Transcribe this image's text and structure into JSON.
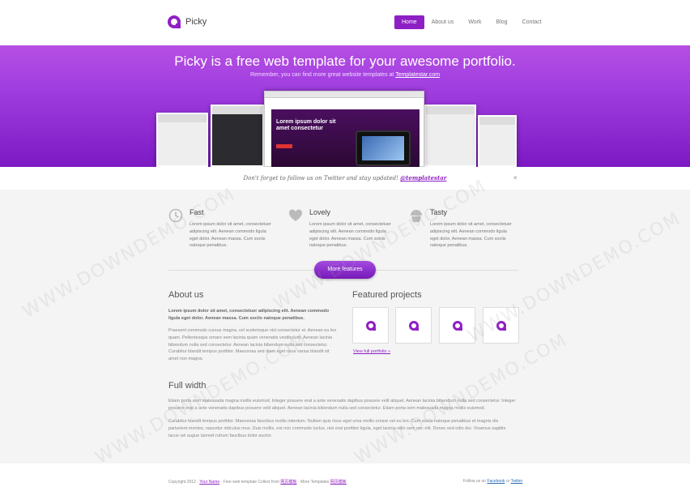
{
  "header": {
    "logo_text": "Picky",
    "nav": [
      "Home",
      "About us",
      "Work",
      "Blog",
      "Contact"
    ]
  },
  "hero": {
    "title": "Picky is a free web template for your awesome portfolio.",
    "subtitle_prefix": "Remember, you can find more great website templates at ",
    "subtitle_link": "Templatestar.com",
    "mockup_headline": "Lorem ipsum dolor sit amet consectetur"
  },
  "notice": {
    "text": "Don't forget to follow us on Twitter and stay updated! ",
    "handle": "@templatestar",
    "close": "×"
  },
  "features": [
    {
      "title": "Fast",
      "icon": "clock-icon",
      "text": "Lorem ipsum dolor sit amet, consectetuer adipiscing elit. Aenean commodo ligula eget dolor. Aenean massa. Cum sociis natoque penatibus."
    },
    {
      "title": "Lovely",
      "icon": "heart-icon",
      "text": "Lorem ipsum dolor sit amet, consectetuer adipiscing elit. Aenean commodo ligula eget dolor. Aenean massa. Cum sociis natoque penatibus."
    },
    {
      "title": "Tasty",
      "icon": "cupcake-icon",
      "text": "Lorem ipsum dolor sit amet, consectetuer adipiscing elit. Aenean commodo ligula eget dolor. Aenean massa. Cum sociis natoque penatibus."
    }
  ],
  "more_features": "More features",
  "about": {
    "title": "About us",
    "lead": "Lorem ipsum dolor sit amet, consectetuer adipiscing elit. Aenean commodo ligula eget dolor. Aenean massa. Cum sociis natoque penatibus.",
    "body": "Praesent commodo cursus magna, vel scelerisque nisl consectetur et. Aenean eu leo quam. Pellentesque ornare sem lacinia quam venenatis vestibulum. Aenean lacinia bibendum nulla sed consectetur. Aenean lacinia bibendum nulla sed consectetur. Curabitur blandit tempus porttitor. Maecenas sed diam eget risus varius blandit sit amet non magna."
  },
  "projects": {
    "title": "Featured projects",
    "view_all": "View full portfolio »"
  },
  "full_width": {
    "title": "Full width",
    "p1": "Etiam porta sem malesuada magna mollis euismod. Integer posuere erat a ante venenatis dapibus posuere velit aliquet. Aenean lacinia bibendum nulla sed consectetur. Integer posuere erat a ante venenatis dapibus posuere velit aliquet. Aenean lacinia bibendum nulla sed consectetur. Etiam porta sem malesuada magna mollis euismod.",
    "p2": "Curabitur blandit tempus porttitor. Maecenas faucibus mollis interdum. Nullam quis risus eget urna mollis ornare vel eu leo. Cum sociis natoque penatibus et magnis dis parturient montes, nascetur ridiculus mus. Duis mollis, est non commodo luctus, nisi erat porttitor ligula, eget lacinia odio sem nec elit. Donec sed odio dui. Vivamus sagittis lacus vel augue laoreet rutrum faucibus dolor auctor."
  },
  "footer": {
    "left_prefix": "Copyright 2012 · ",
    "your_name": "Your Name",
    "left_mid": " · Free web template Collect from ",
    "collect": "网页模板",
    "left_more": " · More Templates ",
    "more_link": "网页模板",
    "right_prefix": "Follow us on ",
    "facebook": "Facebook",
    "or": " or ",
    "twitter": "Twitter"
  },
  "watermark": "WWW.DOWNDEMO.COM",
  "colors": {
    "accent": "#8e1fc4",
    "hero_top": "#b54fe3",
    "hero_bottom": "#7c19c3"
  }
}
